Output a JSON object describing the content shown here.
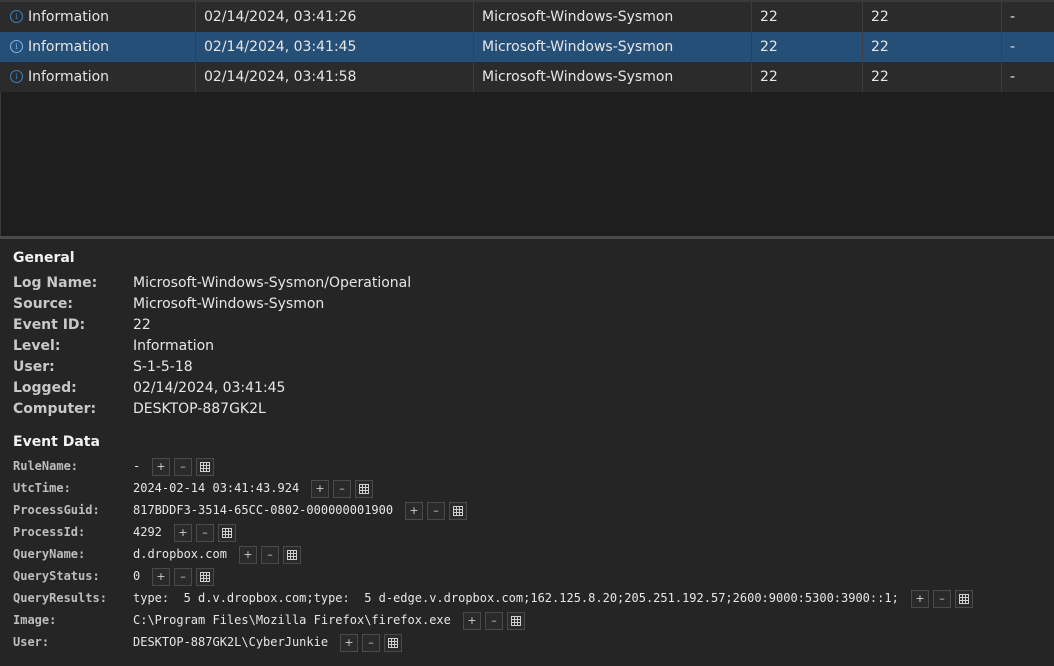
{
  "table": {
    "rows": [
      {
        "level": "Information",
        "date": "02/14/2024, 03:41:26",
        "source": "Microsoft-Windows-Sysmon",
        "event_id": "22",
        "task": "22",
        "extra": "-"
      },
      {
        "level": "Information",
        "date": "02/14/2024, 03:41:45",
        "source": "Microsoft-Windows-Sysmon",
        "event_id": "22",
        "task": "22",
        "extra": "-"
      },
      {
        "level": "Information",
        "date": "02/14/2024, 03:41:58",
        "source": "Microsoft-Windows-Sysmon",
        "event_id": "22",
        "task": "22",
        "extra": "-"
      }
    ]
  },
  "details": {
    "general_title": "General",
    "general": [
      {
        "label": "Log Name:",
        "value": "Microsoft-Windows-Sysmon/Operational"
      },
      {
        "label": "Source:",
        "value": "Microsoft-Windows-Sysmon"
      },
      {
        "label": "Event ID:",
        "value": "22"
      },
      {
        "label": "Level:",
        "value": "Information"
      },
      {
        "label": "User:",
        "value": "S-1-5-18"
      },
      {
        "label": "Logged:",
        "value": "02/14/2024, 03:41:45"
      },
      {
        "label": "Computer:",
        "value": "DESKTOP-887GK2L"
      }
    ],
    "event_data_title": "Event Data",
    "event_data": [
      {
        "label": "RuleName:",
        "value": "-"
      },
      {
        "label": "UtcTime:",
        "value": "2024-02-14 03:41:43.924"
      },
      {
        "label": "ProcessGuid:",
        "value": "817BDDF3-3514-65CC-0802-000000001900"
      },
      {
        "label": "ProcessId:",
        "value": "4292"
      },
      {
        "label": "QueryName:",
        "value": "d.dropbox.com"
      },
      {
        "label": "QueryStatus:",
        "value": "0"
      },
      {
        "label": "QueryResults:",
        "value": "type:  5 d.v.dropbox.com;type:  5 d-edge.v.dropbox.com;162.125.8.20;205.251.192.57;2600:9000:5300:3900::1;"
      },
      {
        "label": "Image:",
        "value": "C:\\Program Files\\Mozilla Firefox\\firefox.exe"
      },
      {
        "label": "User:",
        "value": "DESKTOP-887GK2L\\CyberJunkie"
      }
    ],
    "action_labels": {
      "include": "+",
      "exclude": "–"
    }
  },
  "colors": {
    "selected_row": "#264f78",
    "info_icon": "#3b82c4"
  }
}
